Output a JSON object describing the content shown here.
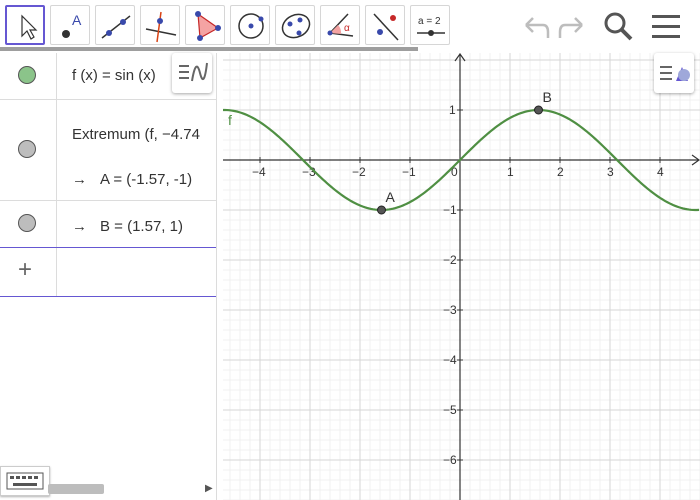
{
  "toolbar": {
    "tools": [
      {
        "name": "move-tool-button",
        "icon": "cursor-icon",
        "selected": true
      },
      {
        "name": "point-tool-button",
        "icon": "point-icon",
        "label": "A"
      },
      {
        "name": "line-tool-button",
        "icon": "line-icon"
      },
      {
        "name": "perpendicular-line-tool-button",
        "icon": "perpendicular-icon"
      },
      {
        "name": "polygon-tool-button",
        "icon": "polygon-icon"
      },
      {
        "name": "circle-tool-button",
        "icon": "circle-icon"
      },
      {
        "name": "ellipse-tool-button",
        "icon": "ellipse-icon"
      },
      {
        "name": "angle-tool-button",
        "icon": "angle-icon",
        "label": "α"
      },
      {
        "name": "reflect-tool-button",
        "icon": "reflect-icon"
      },
      {
        "name": "slider-tool-button",
        "icon": "slider-icon",
        "label": "a = 2"
      }
    ],
    "undo_icon": "undo-icon",
    "redo_icon": "redo-icon",
    "search_icon": "search-icon",
    "menu_icon": "menu-icon"
  },
  "algebra": {
    "rows": [
      {
        "marble_color": "#8bc48a",
        "expr": "f (x)  =  sin (x)"
      },
      {
        "marble_color": "#bdbdbd",
        "expr": "Extremum (f, −4.74",
        "sub_label": "A = (-1.57, -1)"
      },
      {
        "marble_color": "#bdbdbd",
        "sub_label": "B = (1.57, 1)"
      }
    ],
    "arrow": "→",
    "add_label": "+"
  },
  "graphics": {
    "function_label": "f",
    "curve_color": "#4f8f43",
    "points": [
      {
        "label": "A",
        "x": -1.57,
        "y": -1
      },
      {
        "label": "B",
        "x": 1.57,
        "y": 1
      }
    ],
    "x_axis_labels": [
      "−4",
      "−3",
      "−2",
      "−1",
      "0",
      "1",
      "2",
      "3",
      "4"
    ],
    "y_axis_labels": [
      "1",
      "−1",
      "−2",
      "−3",
      "−4",
      "−5",
      "−6"
    ]
  },
  "colors": {
    "accent": "#6557d2",
    "curve": "#4f8f43"
  }
}
